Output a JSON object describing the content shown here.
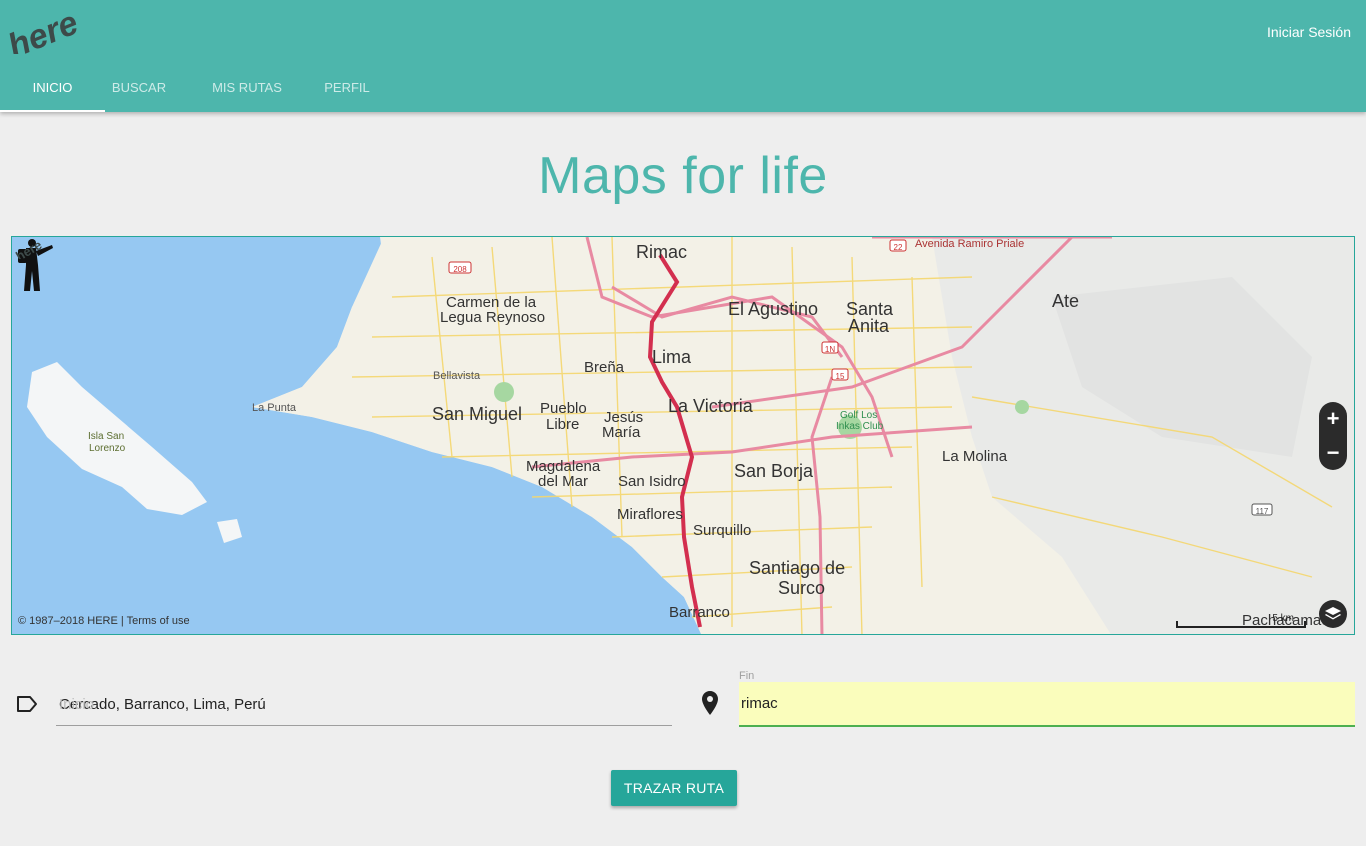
{
  "header": {
    "login_label": "Iniciar Sesión",
    "tabs": [
      {
        "label": "INICIO",
        "active": true
      },
      {
        "label": "BUSCAR",
        "active": false
      },
      {
        "label": "MIS RUTAS",
        "active": false
      },
      {
        "label": "PERFIL",
        "active": false
      }
    ],
    "brand_color": "#4db6ac"
  },
  "page": {
    "title": "Maps for life"
  },
  "map": {
    "labels": {
      "rimac": "Rimac",
      "carmen": "Carmen de la",
      "carmen2": "Legua Reynoso",
      "el_agustino": "El Agustino",
      "santa_anita": "Santa",
      "santa_anita2": "Anita",
      "ate": "Ate",
      "lima": "Lima",
      "brena": "Breña",
      "bellavista": "Bellavista",
      "la_punta": "La Punta",
      "isla": "Isla San",
      "isla2": "Lorenzo",
      "san_miguel": "San Miguel",
      "pueblo_libre": "Pueblo",
      "pueblo_libre2": "Libre",
      "jesus_maria": "Jesús",
      "jesus_maria2": "María",
      "la_victoria": "La Victoria",
      "golf": "Golf Los",
      "golf2": "Inkas Club",
      "la_molina": "La Molina",
      "magdalena": "Magdalena",
      "magdalena2": "del Mar",
      "san_isidro": "San Isidro",
      "san_borja": "San Borja",
      "miraflores": "Miraflores",
      "surquillo": "Surquillo",
      "santiago": "Santiago de",
      "santiago2": "Surco",
      "barranco": "Barranco",
      "pachacamac": "Pachacamac",
      "avenida": "Avenida Ramiro Priale",
      "shield_22": "22",
      "shield_208": "208",
      "shield_1n": "1N",
      "shield_15": "15",
      "shield_117": "117",
      "scale": "5 km"
    },
    "zoom_in": "+",
    "zoom_out": "−",
    "copyright": "© 1987–2018 HERE | ",
    "terms": "Terms of use"
  },
  "form": {
    "start_value": "Cercado, Barranco, Lima, Perú",
    "start_ghost": "Inicio",
    "end_label": "Fin",
    "end_value": "rimac",
    "submit_label": "TRAZAR RUTA"
  }
}
